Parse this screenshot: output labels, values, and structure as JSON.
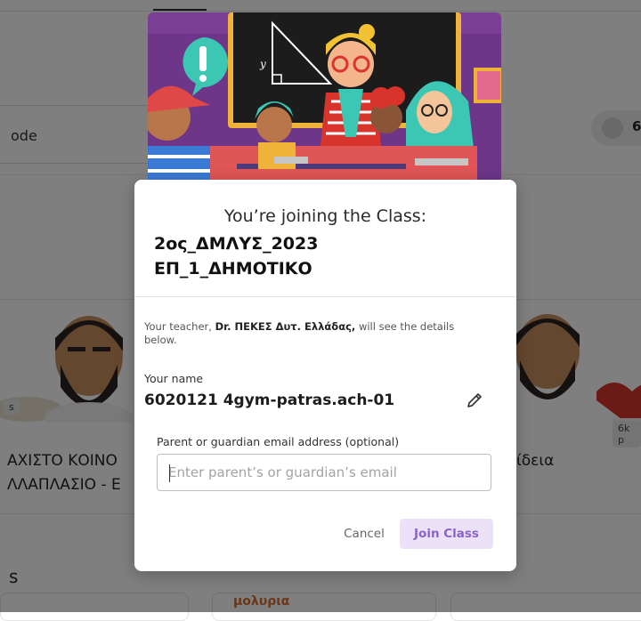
{
  "background": {
    "search_partial_text": "ode",
    "right_pill_partial_text": "6",
    "cards": [
      {
        "title_line1": "ΑΧΙΣΤΟ ΚΟΙΝΟ",
        "title_line2": "ΛΛΑΠΛΑΣΙΟ - Ε",
        "badge": "s"
      },
      {
        "title_line1": "ίδεια",
        "badge": "6k p"
      }
    ],
    "section_partial_letter": "s",
    "bottom_card_partial_text": "μολυρια"
  },
  "modal": {
    "heading": "You’re joining the Class:",
    "class_name_line1": "2ος_ΔΜΛΥΣ_2023",
    "class_name_line2": "ΕΠ_1_ΔΗΜΟΤΙΚΟ",
    "teacher_prefix": "Your teacher, ",
    "teacher_name": "Dr. ΠΕΚΕΣ Δυτ. Ελλάδας,",
    "teacher_suffix": " will see the details below.",
    "name_label": "Your name",
    "name_value": "6020121 4gym-patras.ach-01",
    "email_label": "Parent or guardian email address (optional)",
    "email_placeholder": "Enter parent’s or guardian’s email",
    "email_value": "",
    "cancel_label": "Cancel",
    "join_label": "Join Class",
    "colors": {
      "join_bg": "#ece2f8",
      "join_text": "#8b62c9",
      "hero_bg": "#7a3f94"
    }
  }
}
